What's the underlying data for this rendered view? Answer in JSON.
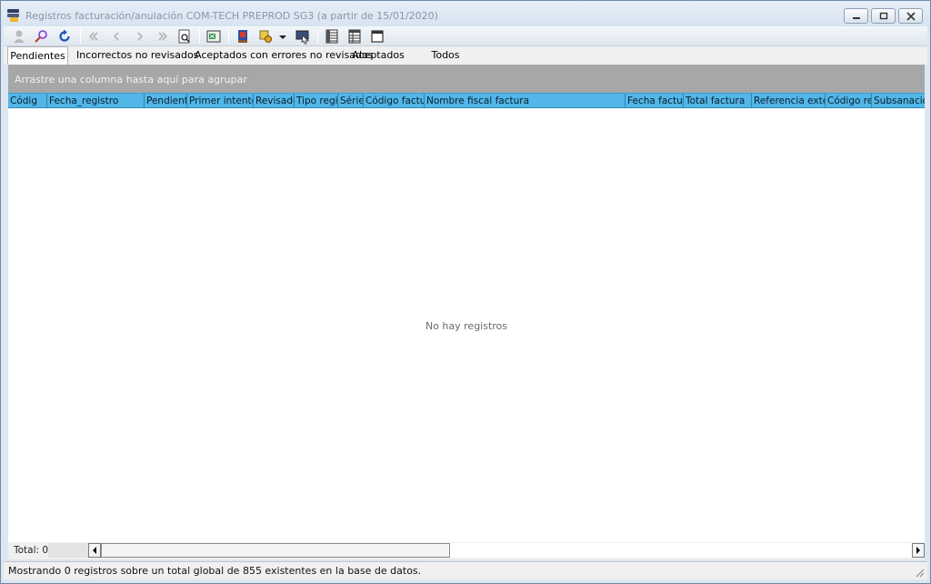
{
  "window": {
    "title": "Registros facturación/anulación COM-TECH PREPROD SG3 (a partir de 15/01/2020)"
  },
  "toolbar": {
    "icons": [
      "user-icon",
      "search-icon",
      "refresh-icon",
      "first-record-icon",
      "previous-record-icon",
      "next-record-icon",
      "last-record-icon",
      "print-preview-icon",
      "excel-export-icon",
      "book-icon",
      "settings-icon",
      "dropdown-arrow-icon",
      "screen-select-icon",
      "columns-icon",
      "layout-icon",
      "window-icon"
    ]
  },
  "tabs": [
    {
      "label": "Pendientes",
      "active": true
    },
    {
      "label": "Incorrectos no revisados",
      "active": false
    },
    {
      "label": "Aceptados con errores no revisados",
      "active": false
    },
    {
      "label": "Aceptados",
      "active": false
    },
    {
      "label": "Todos",
      "active": false
    }
  ],
  "group_panel": {
    "hint": "Arrastre una columna hasta aquí para agrupar"
  },
  "grid": {
    "columns": [
      "Códig",
      "Fecha_registro",
      "Pendiente",
      "Primer intento",
      "Revisado",
      "Tipo regist",
      "Série",
      "Código factura",
      "Nombre fiscal factura",
      "Fecha factura",
      "Total factura",
      "Referencia extern",
      "Código reg",
      "Subsanación"
    ],
    "empty_message": "No hay registros"
  },
  "footer": {
    "total_label": "Total: 0"
  },
  "status": {
    "text": "Mostrando 0 registros sobre un total global de 855 existentes en la base de datos."
  },
  "colors": {
    "header_blue": "#52b6e8",
    "group_panel_gray": "#a7a7a7",
    "accent_yellow": "#f2b62c"
  }
}
